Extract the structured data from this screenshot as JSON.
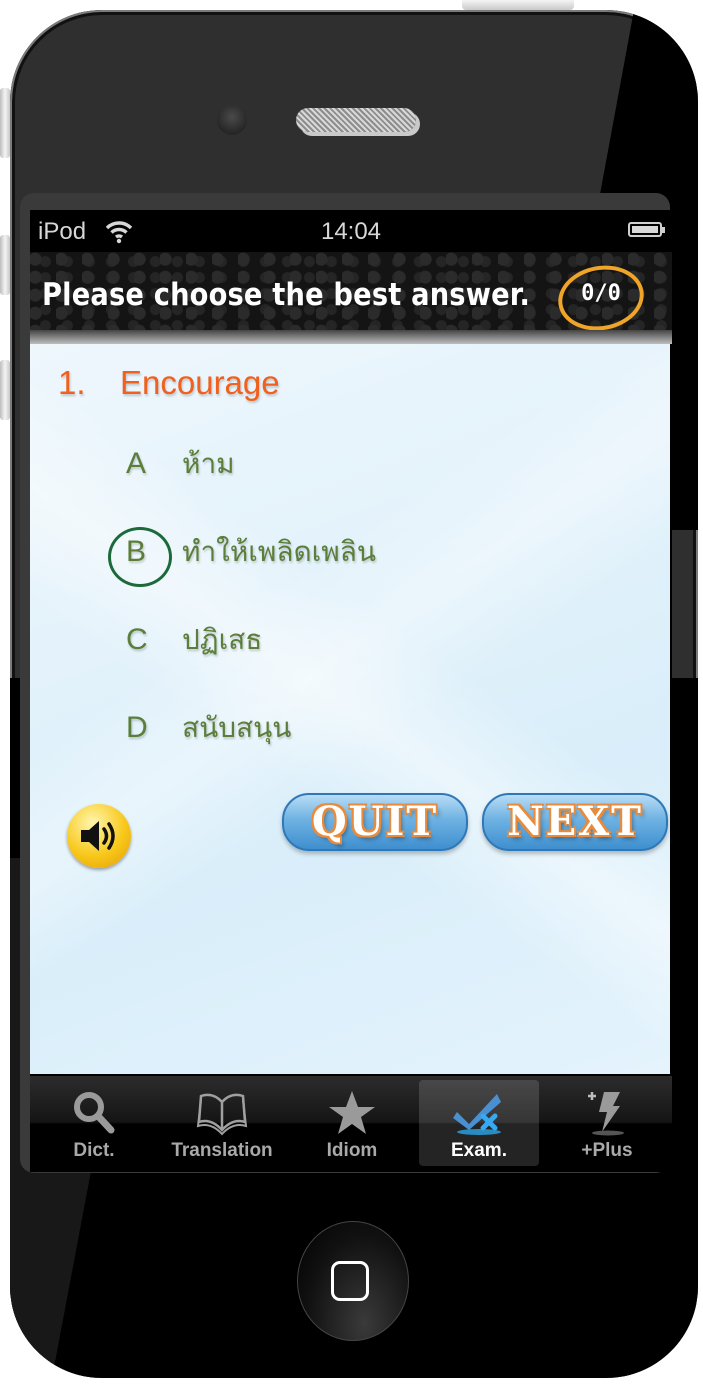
{
  "status_bar": {
    "carrier": "iPod",
    "time": "14:04",
    "wifi_icon": "wifi-icon",
    "battery_icon": "battery-full-icon"
  },
  "header": {
    "title": "Please choose the best answer.",
    "score": "0/0"
  },
  "question": {
    "number": "1.",
    "word": "Encourage",
    "selected": "B",
    "options": [
      {
        "letter": "A",
        "text": "ห้าม"
      },
      {
        "letter": "B",
        "text": "ทำให้เพลิดเพลิน"
      },
      {
        "letter": "C",
        "text": "ปฏิเสธ"
      },
      {
        "letter": "D",
        "text": "สนับสนุน"
      }
    ]
  },
  "controls": {
    "sound_icon": "speaker-icon",
    "quit_label": "QUIT",
    "next_label": "NEXT"
  },
  "tab_bar": {
    "active": "Exam.",
    "tabs": [
      {
        "label": "Dict.",
        "icon": "search-icon"
      },
      {
        "label": "Translation",
        "icon": "book-icon"
      },
      {
        "label": "Idiom",
        "icon": "star-icon"
      },
      {
        "label": "Exam.",
        "icon": "check-x-icon"
      },
      {
        "label": "+Plus",
        "icon": "lightning-plus-icon"
      }
    ]
  },
  "colors": {
    "question_color": "#f0601e",
    "option_color": "#5b7f3a",
    "score_circle": "#f0a428",
    "selection_circle": "#1c6a3a",
    "button_blue": "#4f9fd9"
  }
}
